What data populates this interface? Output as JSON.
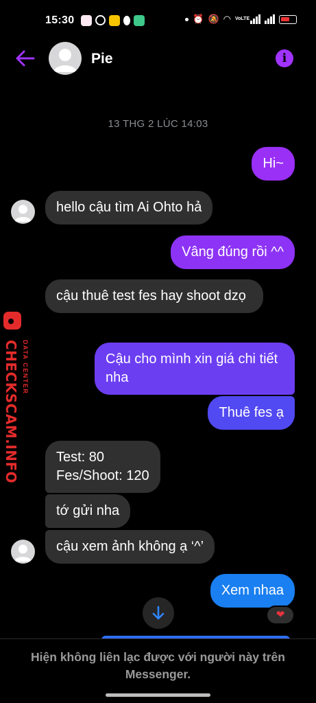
{
  "status_bar": {
    "time": "15:30",
    "carrier_badge": "VoLTE",
    "colors": {
      "battery_low": "#e33333"
    }
  },
  "header": {
    "contact_name": "Pie",
    "back_icon": "arrow-left-icon",
    "info_icon": "info-icon",
    "info_glyph": "i",
    "accent": "#a033ff"
  },
  "conversation": {
    "timestamp": "13 THG 2 LÚC 14:03",
    "messages": [
      {
        "dir": "out",
        "text": "Hi~"
      },
      {
        "dir": "in",
        "text": "hello cậu tìm Ai Ohto hả"
      },
      {
        "dir": "out",
        "text": "Vâng đúng rồi ^^"
      },
      {
        "dir": "in",
        "text": "cậu thuê test fes hay shoot dzọ"
      },
      {
        "dir": "out",
        "text": "Cậu cho mình xin giá chi tiết nha"
      },
      {
        "dir": "out",
        "text": "Thuê fes ạ"
      },
      {
        "dir": "in",
        "text": "Test: 80\nFes/Shoot: 120"
      },
      {
        "dir": "in",
        "text": "tớ gửi nha"
      },
      {
        "dir": "in",
        "text": "cậu xem ảnh không ạ ‘^’"
      },
      {
        "dir": "out",
        "text": "Xem nhaa"
      }
    ],
    "reaction": "❤️",
    "bubble_colors": {
      "incoming": "#303030",
      "outgoing_top": "#9b2ff5",
      "outgoing_bottom": "#1a7ff0"
    }
  },
  "footer": {
    "notice": "Hiện không liên lạc được với người này trên Messenger."
  },
  "watermark": {
    "brand": "CHECKSCAM.INFO",
    "tag": "DATA CENTER"
  }
}
